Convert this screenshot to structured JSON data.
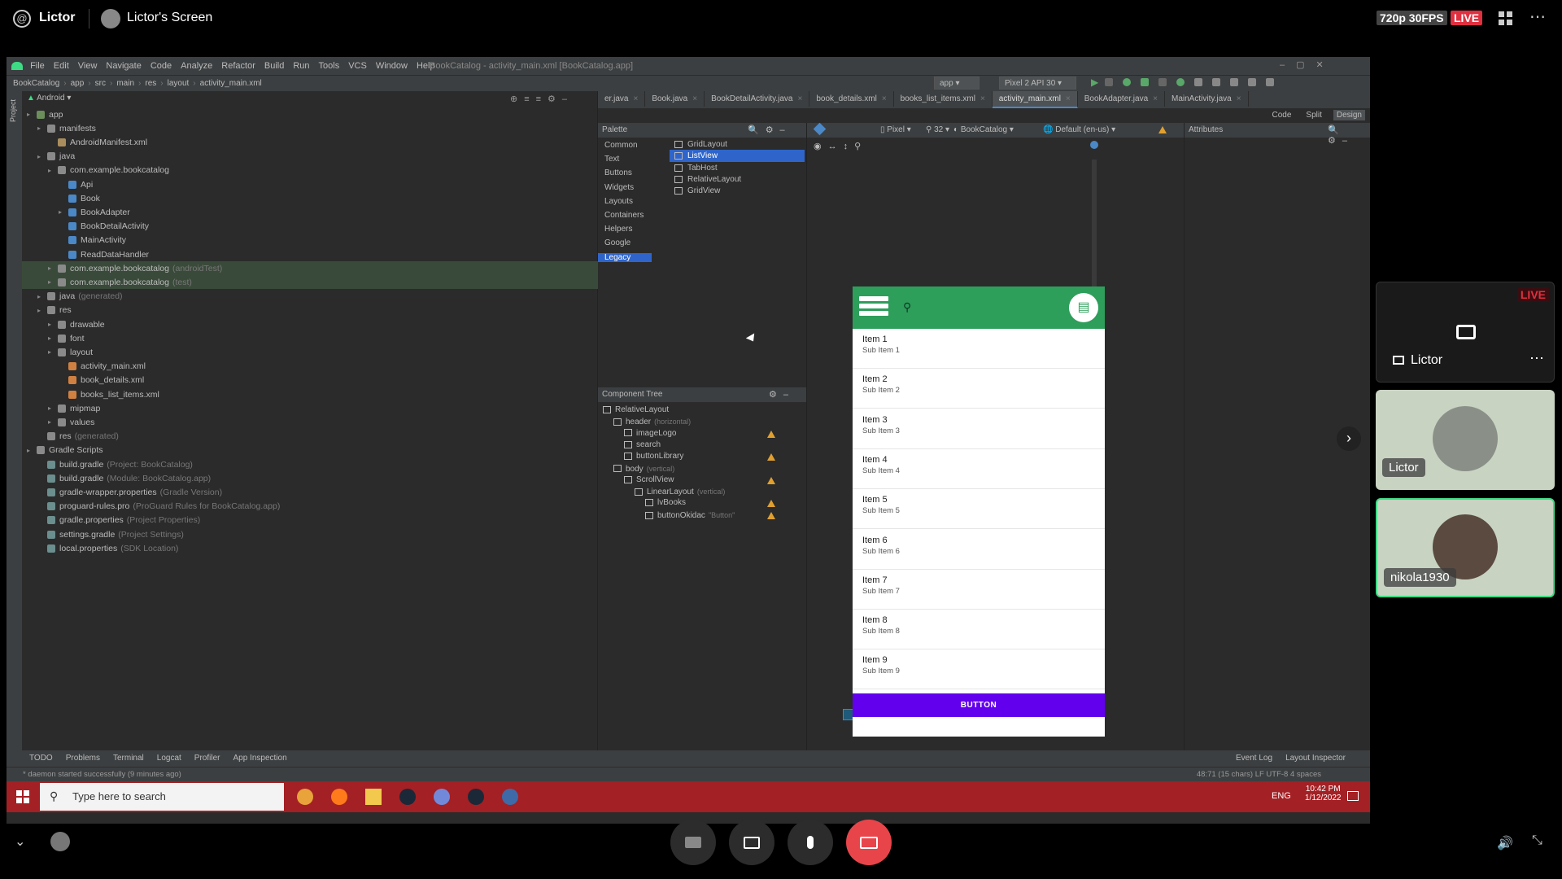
{
  "call": {
    "app_name": "Lictor",
    "screen_title": "Lictor's Screen",
    "quality": "720p 30FPS",
    "live": "LIVE"
  },
  "ide": {
    "menu": [
      "File",
      "Edit",
      "View",
      "Navigate",
      "Code",
      "Analyze",
      "Refactor",
      "Build",
      "Run",
      "Tools",
      "VCS",
      "Window",
      "Help"
    ],
    "window_title": "BookCatalog - activity_main.xml [BookCatalog.app]",
    "breadcrumb": [
      "BookCatalog",
      "app",
      "src",
      "main",
      "res",
      "layout",
      "activity_main.xml"
    ],
    "run_config": "app",
    "device": "Pixel 2 API 30",
    "project_view": "Android",
    "tree": [
      {
        "label": "app",
        "sub": ""
      },
      {
        "label": "manifests",
        "sub": ""
      },
      {
        "label": "AndroidManifest.xml",
        "sub": ""
      },
      {
        "label": "java",
        "sub": ""
      },
      {
        "label": "com.example.bookcatalog",
        "sub": ""
      },
      {
        "label": "Api",
        "sub": ""
      },
      {
        "label": "Book",
        "sub": ""
      },
      {
        "label": "BookAdapter",
        "sub": ""
      },
      {
        "label": "BookDetailActivity",
        "sub": ""
      },
      {
        "label": "MainActivity",
        "sub": ""
      },
      {
        "label": "ReadDataHandler",
        "sub": ""
      },
      {
        "label": "com.example.bookcatalog",
        "sub": "(androidTest)"
      },
      {
        "label": "com.example.bookcatalog",
        "sub": "(test)"
      },
      {
        "label": "java",
        "sub": "(generated)"
      },
      {
        "label": "res",
        "sub": ""
      },
      {
        "label": "drawable",
        "sub": ""
      },
      {
        "label": "font",
        "sub": ""
      },
      {
        "label": "layout",
        "sub": ""
      },
      {
        "label": "activity_main.xml",
        "sub": ""
      },
      {
        "label": "book_details.xml",
        "sub": ""
      },
      {
        "label": "books_list_items.xml",
        "sub": ""
      },
      {
        "label": "mipmap",
        "sub": ""
      },
      {
        "label": "values",
        "sub": ""
      },
      {
        "label": "res",
        "sub": "(generated)"
      },
      {
        "label": "Gradle Scripts",
        "sub": ""
      },
      {
        "label": "build.gradle",
        "sub": "(Project: BookCatalog)"
      },
      {
        "label": "build.gradle",
        "sub": "(Module: BookCatalog.app)"
      },
      {
        "label": "gradle-wrapper.properties",
        "sub": "(Gradle Version)"
      },
      {
        "label": "proguard-rules.pro",
        "sub": "(ProGuard Rules for BookCatalog.app)"
      },
      {
        "label": "gradle.properties",
        "sub": "(Project Properties)"
      },
      {
        "label": "settings.gradle",
        "sub": "(Project Settings)"
      },
      {
        "label": "local.properties",
        "sub": "(SDK Location)"
      }
    ],
    "tabs": [
      "er.java",
      "Book.java",
      "BookDetailActivity.java",
      "book_details.xml",
      "books_list_items.xml",
      "activity_main.xml",
      "BookAdapter.java",
      "MainActivity.java"
    ],
    "view_modes": [
      "Code",
      "Split",
      "Design"
    ],
    "palette_title": "Palette",
    "palette_categories": [
      "Common",
      "Text",
      "Buttons",
      "Widgets",
      "Layouts",
      "Containers",
      "Helpers",
      "Google",
      "Legacy"
    ],
    "palette_items": [
      "GridLayout",
      "ListView",
      "TabHost",
      "RelativeLayout",
      "GridView"
    ],
    "design_toolbar": {
      "device": "Pixel",
      "api": "32",
      "theme": "BookCatalog",
      "locale": "Default (en-us)"
    },
    "attributes_title": "Attributes",
    "component_tree_title": "Component Tree",
    "component_tree": [
      {
        "label": "RelativeLayout",
        "sub": ""
      },
      {
        "label": "header",
        "sub": "(horizontal)"
      },
      {
        "label": "imageLogo",
        "sub": ""
      },
      {
        "label": "search",
        "sub": ""
      },
      {
        "label": "buttonLibrary",
        "sub": ""
      },
      {
        "label": "body",
        "sub": "(vertical)"
      },
      {
        "label": "ScrollView",
        "sub": ""
      },
      {
        "label": "LinearLayout",
        "sub": "(vertical)"
      },
      {
        "label": "lvBooks",
        "sub": ""
      },
      {
        "label": "buttonOkidac",
        "sub": "\"Button\""
      }
    ],
    "preview_items": [
      {
        "title": "Item 1",
        "sub": "Sub Item 1"
      },
      {
        "title": "Item 2",
        "sub": "Sub Item 2"
      },
      {
        "title": "Item 3",
        "sub": "Sub Item 3"
      },
      {
        "title": "Item 4",
        "sub": "Sub Item 4"
      },
      {
        "title": "Item 5",
        "sub": "Sub Item 5"
      },
      {
        "title": "Item 6",
        "sub": "Sub Item 6"
      },
      {
        "title": "Item 7",
        "sub": "Sub Item 7"
      },
      {
        "title": "Item 8",
        "sub": "Sub Item 8"
      },
      {
        "title": "Item 9",
        "sub": "Sub Item 9"
      }
    ],
    "preview_button": "BUTTON",
    "bottom_tools": [
      "TODO",
      "Problems",
      "Terminal",
      "Logcat",
      "Profiler",
      "App Inspection"
    ],
    "bottom_right_tools": [
      "Event Log",
      "Layout Inspector"
    ],
    "status_message": "* daemon started successfully (9 minutes ago)",
    "status_right": "48:71 (15 chars)   LF   UTF-8   4 spaces"
  },
  "taskbar": {
    "search_placeholder": "Type here to search",
    "lang": "ENG",
    "time": "10:42 PM",
    "date": "1/12/2022"
  },
  "participants": [
    {
      "name": "Lictor",
      "live": "LIVE"
    },
    {
      "name": "Lictor"
    },
    {
      "name": "nikola1930"
    }
  ]
}
